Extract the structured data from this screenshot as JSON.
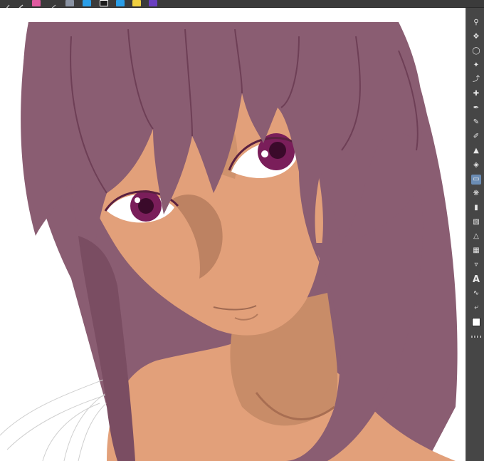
{
  "app": {
    "accent": "#6b8db5",
    "topbar_bg": "#3b3b3b",
    "toolbar_bg": "#464646"
  },
  "topbar": {
    "buttons": [
      {
        "icon": "pen-tool-icon",
        "color": "#3b3b3b"
      },
      {
        "icon": "pencil-tool-icon",
        "color": "#3b3b3b"
      },
      {
        "icon": "color-pink-swatch-icon",
        "color": "#e05aa0"
      },
      {
        "icon": "brush-tool-icon",
        "color": "#3b3b3b"
      },
      {
        "icon": "gray-fill-icon",
        "color": "#8a93a3"
      },
      {
        "icon": "blue-layer-icon",
        "color": "#2a9ee8"
      },
      {
        "icon": "black-white-icon",
        "color": "#1b1b1b"
      },
      {
        "icon": "blue-layer-2-icon",
        "color": "#2a9ee8"
      },
      {
        "icon": "yellow-icon",
        "color": "#f0d040"
      },
      {
        "icon": "purple-icon",
        "color": "#6a3fc0"
      }
    ]
  },
  "toolbar": {
    "text_tool_label": "A"
  },
  "artwork": {
    "hair_color": "#8a5d72",
    "skin_color": "#e2a07a",
    "shadow_color": "#b47a5c",
    "eye_color": "#7a1e5a"
  }
}
